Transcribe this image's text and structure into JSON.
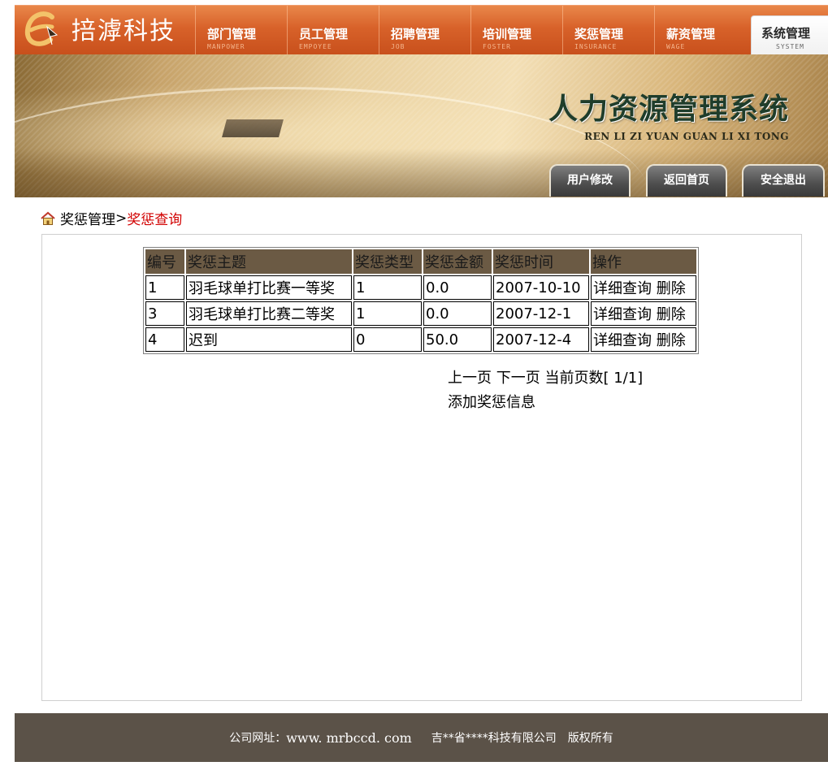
{
  "app": {
    "logo_text": "掊滹科技"
  },
  "nav": {
    "items": [
      {
        "cn": "部门管理",
        "en": "MANPOWER"
      },
      {
        "cn": "员工管理",
        "en": "EMPOYEE"
      },
      {
        "cn": "招聘管理",
        "en": "JOB"
      },
      {
        "cn": "培训管理",
        "en": "FOSTER"
      },
      {
        "cn": "奖惩管理",
        "en": "INSURANCE"
      },
      {
        "cn": "薪资管理",
        "en": "WAGE"
      },
      {
        "cn": "系统管理",
        "en": "SYSTEM"
      }
    ],
    "active_index": 6
  },
  "banner": {
    "title": "人力资源管理系统",
    "subtitle": "REN LI ZI YUAN GUAN LI XI TONG",
    "buttons": [
      "用户修改",
      "返回首页",
      "安全退出"
    ]
  },
  "breadcrumb": {
    "parent": "奖惩管理",
    "separator": ">",
    "current": "奖惩查询"
  },
  "table": {
    "headers": [
      "编号",
      "奖惩主题",
      "奖惩类型",
      "奖惩金额",
      "奖惩时间",
      "操作"
    ],
    "rows": [
      {
        "id": "1",
        "subject": "羽毛球单打比赛一等奖",
        "type": "1",
        "amount": "0.0",
        "date": "2007-10-10",
        "detail": "详细查询",
        "delete": "删除"
      },
      {
        "id": "3",
        "subject": "羽毛球单打比赛二等奖",
        "type": "1",
        "amount": "0.0",
        "date": "2007-12-1",
        "detail": "详细查询",
        "delete": "删除"
      },
      {
        "id": "4",
        "subject": "迟到",
        "type": "0",
        "amount": "50.0",
        "date": "2007-12-4",
        "detail": "详细查询",
        "delete": "删除"
      }
    ]
  },
  "pager": {
    "prev": "上一页",
    "next": "下一页",
    "current_label": "当前页数[ 1/1]"
  },
  "add_link": "添加奖惩信息",
  "footer": {
    "url_label": "公司网址：",
    "url": "www. mrbccd. com",
    "company": "吉**省****科技有限公司",
    "rights": "版权所有"
  },
  "colors": {
    "nav_orange": "#d8622a",
    "crumb_current": "#d10000",
    "table_header": "#6b5a44",
    "footer_bg": "#5b5248"
  }
}
